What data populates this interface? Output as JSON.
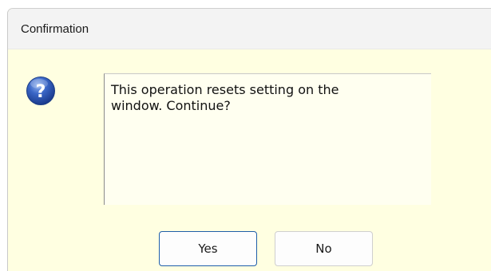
{
  "dialog": {
    "title": "Confirmation",
    "icon": "question-icon",
    "message": "This operation resets setting on the\nwindow. Continue?",
    "buttons": {
      "yes_label": "Yes",
      "no_label": "No"
    }
  },
  "colors": {
    "body_background": "#ffffe1",
    "titlebar_background": "#f3f3f3",
    "icon_blue": "#2d55b5",
    "default_button_border": "#1e5ea8"
  }
}
